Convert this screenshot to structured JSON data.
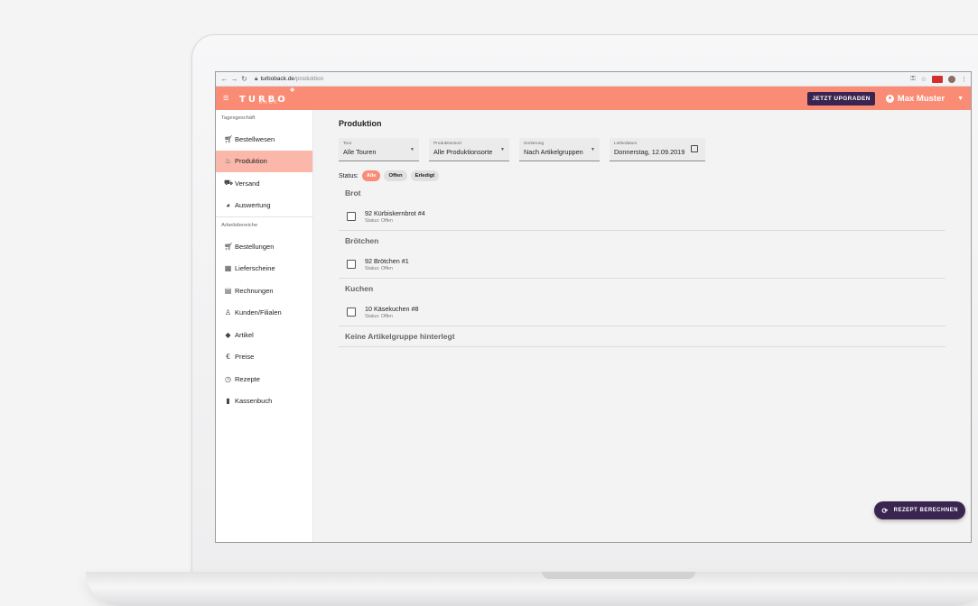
{
  "browser": {
    "url_host": "turboback.de",
    "url_path": "/produktion"
  },
  "app_bar": {
    "logo_main": "TURBO",
    "logo_sub": "BACK",
    "upgrade_label": "JETZT UPGRADEN",
    "user_name": "Max Muster"
  },
  "sidebar": {
    "section_daily": "Tagesgeschäft",
    "section_work": "Arbeitsbereiche",
    "daily_items": [
      {
        "label": "Bestellwesen",
        "icon": "cart-icon"
      },
      {
        "label": "Produktion",
        "icon": "production-icon",
        "active": true
      },
      {
        "label": "Versand",
        "icon": "truck-icon"
      },
      {
        "label": "Auswertung",
        "icon": "pie-chart-icon"
      }
    ],
    "work_items": [
      {
        "label": "Bestellungen",
        "icon": "cart-icon"
      },
      {
        "label": "Lieferscheine",
        "icon": "calendar-icon"
      },
      {
        "label": "Rechnungen",
        "icon": "invoice-icon"
      },
      {
        "label": "Kunden/Filialen",
        "icon": "person-icon"
      },
      {
        "label": "Artikel",
        "icon": "tag-icon"
      },
      {
        "label": "Preise",
        "icon": "euro-icon"
      },
      {
        "label": "Rezepte",
        "icon": "clock-icon"
      },
      {
        "label": "Kassenbuch",
        "icon": "book-icon"
      }
    ]
  },
  "main": {
    "title": "Produktion",
    "filters": {
      "tour": {
        "label": "Tour",
        "value": "Alle Touren"
      },
      "ort": {
        "label": "Produktionsort",
        "value": "Alle Produktionsorte"
      },
      "sort": {
        "label": "Sortierung",
        "value": "Nach Artikelgruppen"
      },
      "date": {
        "label": "Lieferdatum",
        "value": "Donnerstag, 12.09.2019"
      }
    },
    "status_label": "Status:",
    "chips": {
      "all": "Alle",
      "open": "Offen",
      "done": "Erledigt"
    },
    "groups": [
      {
        "title": "Brot",
        "item": {
          "name": "92 Kürbiskernbrot #4",
          "status": "Status: Offen"
        }
      },
      {
        "title": "Brötchen",
        "item": {
          "name": "92 Brötchen #1",
          "status": "Status: Offen"
        }
      },
      {
        "title": "Kuchen",
        "item": {
          "name": "10 Käsekuchen #8",
          "status": "Status: Offen"
        }
      }
    ],
    "empty_group": "Keine Artikelgruppe hinterlegt",
    "fab_label": "REZEPT BERECHNEN"
  },
  "colors": {
    "accent": "#fa8c76",
    "accent_light": "#fbb8aa",
    "dark": "#3a2550"
  }
}
